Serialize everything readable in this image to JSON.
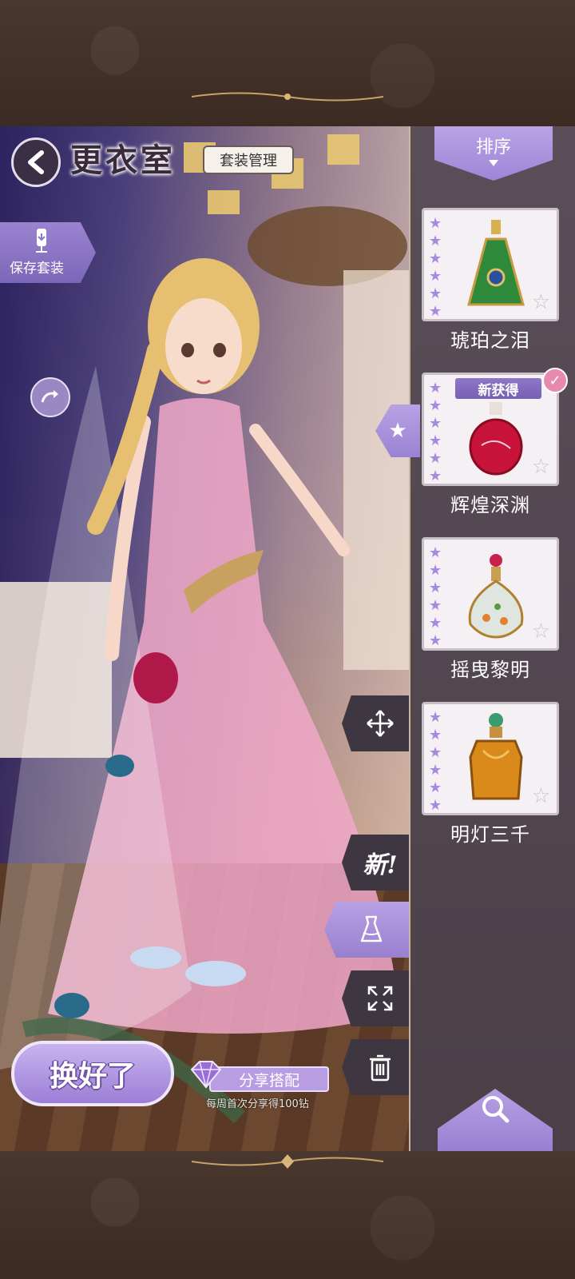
{
  "header": {
    "back_icon": "chevron-left-icon",
    "title": "更衣室",
    "outfit_management": "套装管理"
  },
  "left_actions": {
    "save_outfit": "保存套装",
    "save_icon": "dress-form-download-icon",
    "rotate_icon": "rotate-icon"
  },
  "tools": [
    {
      "name": "move",
      "icon": "move-arrows-icon",
      "label": ""
    },
    {
      "name": "new",
      "icon": "",
      "label": "新!"
    },
    {
      "name": "wardrobe",
      "icon": "dress-icon",
      "label": ""
    },
    {
      "name": "fullscreen",
      "icon": "expand-icon",
      "label": ""
    },
    {
      "name": "delete",
      "icon": "trash-icon",
      "label": ""
    }
  ],
  "bottom": {
    "done": "换好了",
    "share": "分享搭配",
    "share_hint": "每周首次分享得100钻",
    "gem_icon": "diamond-icon"
  },
  "panel": {
    "sort": "排序",
    "new_badge": "新获得",
    "search_icon": "search-icon",
    "items": [
      {
        "name": "琥珀之泪",
        "stars": 6,
        "color": "#2e8a3a"
      },
      {
        "name": "辉煌深渊",
        "stars": 6,
        "color": "#c8143a",
        "new": true,
        "selected": true
      },
      {
        "name": "摇曳黎明",
        "stars": 6,
        "color": "#b83050"
      },
      {
        "name": "明灯三千",
        "stars": 6,
        "color": "#d98a1a"
      }
    ]
  },
  "colors": {
    "accent": "#9b7fd6",
    "frame": "#3b2b23",
    "panel": "#544850"
  }
}
